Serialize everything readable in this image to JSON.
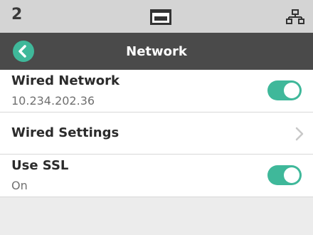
{
  "status_bar": {
    "number": "2",
    "tray_icon": "paper-tray-icon",
    "network_icon": "network-icon"
  },
  "header": {
    "title": "Network",
    "back_icon": "back-arrow-icon"
  },
  "colors": {
    "accent": "#3fb89a",
    "header_bg": "#4a4a4a",
    "status_bg": "#d4d4d4"
  },
  "settings": {
    "wired_network": {
      "label": "Wired Network",
      "value": "10.234.202.36",
      "enabled": true
    },
    "wired_settings": {
      "label": "Wired Settings"
    },
    "use_ssl": {
      "label": "Use SSL",
      "value": "On",
      "enabled": true
    }
  }
}
